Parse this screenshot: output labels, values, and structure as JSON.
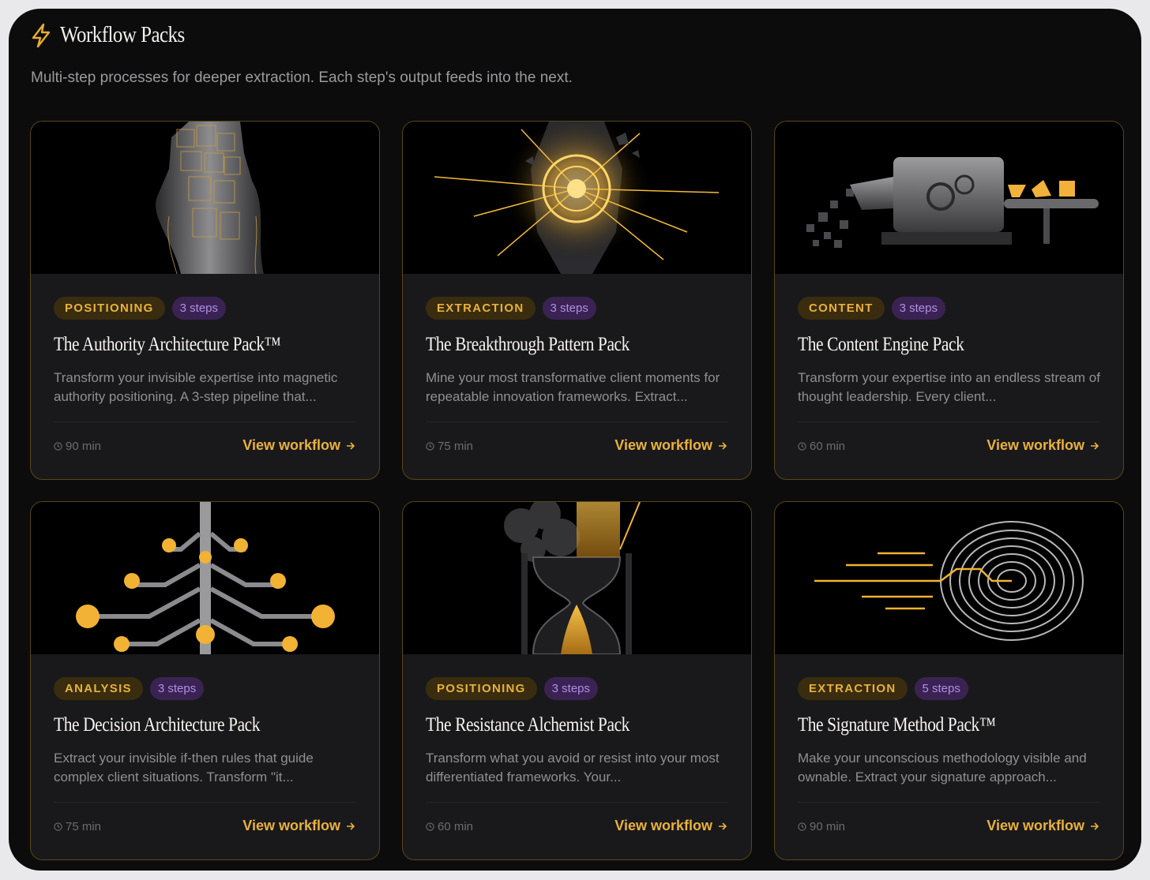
{
  "header": {
    "icon": "lightning-bolt-icon",
    "title": "Workflow Packs",
    "subtitle": "Multi-step processes for deeper extraction. Each step's output feeds into the next."
  },
  "colors": {
    "accent_gold": "#eab13b",
    "steps_purple": "#b08ee8",
    "card_bg": "#19191b",
    "page_bg": "#0c0c0d"
  },
  "cards": [
    {
      "image": "tower-of-cubes-image",
      "category": "POSITIONING",
      "steps": "3 steps",
      "title": "The Authority Architecture Pack™",
      "description": "Transform your invisible expertise into magnetic authority positioning. A 3-step pipeline that...",
      "duration": "90 min",
      "link": "View workflow"
    },
    {
      "image": "glowing-crystal-burst-image",
      "category": "EXTRACTION",
      "steps": "3 steps",
      "title": "The Breakthrough Pattern Pack",
      "description": "Mine your most transformative client moments for repeatable innovation frameworks. Extract...",
      "duration": "75 min",
      "link": "View workflow"
    },
    {
      "image": "content-machine-image",
      "category": "CONTENT",
      "steps": "3 steps",
      "title": "The Content Engine Pack",
      "description": "Transform your expertise into an endless stream of thought leadership. Every client...",
      "duration": "60 min",
      "link": "View workflow"
    },
    {
      "image": "decision-tree-circuit-image",
      "category": "ANALYSIS",
      "steps": "3 steps",
      "title": "The Decision Architecture Pack",
      "description": "Extract your invisible if-then rules that guide complex client situations. Transform \"it...",
      "duration": "75 min",
      "link": "View workflow"
    },
    {
      "image": "hourglass-transformation-image",
      "category": "POSITIONING",
      "steps": "3 steps",
      "title": "The Resistance Alchemist Pack",
      "description": "Transform what you avoid or resist into your most differentiated frameworks. Your...",
      "duration": "60 min",
      "link": "View workflow"
    },
    {
      "image": "fingerprint-circuit-image",
      "category": "EXTRACTION",
      "steps": "5 steps",
      "title": "The Signature Method Pack™",
      "description": "Make your unconscious methodology visible and ownable. Extract your signature approach...",
      "duration": "90 min",
      "link": "View workflow"
    }
  ]
}
